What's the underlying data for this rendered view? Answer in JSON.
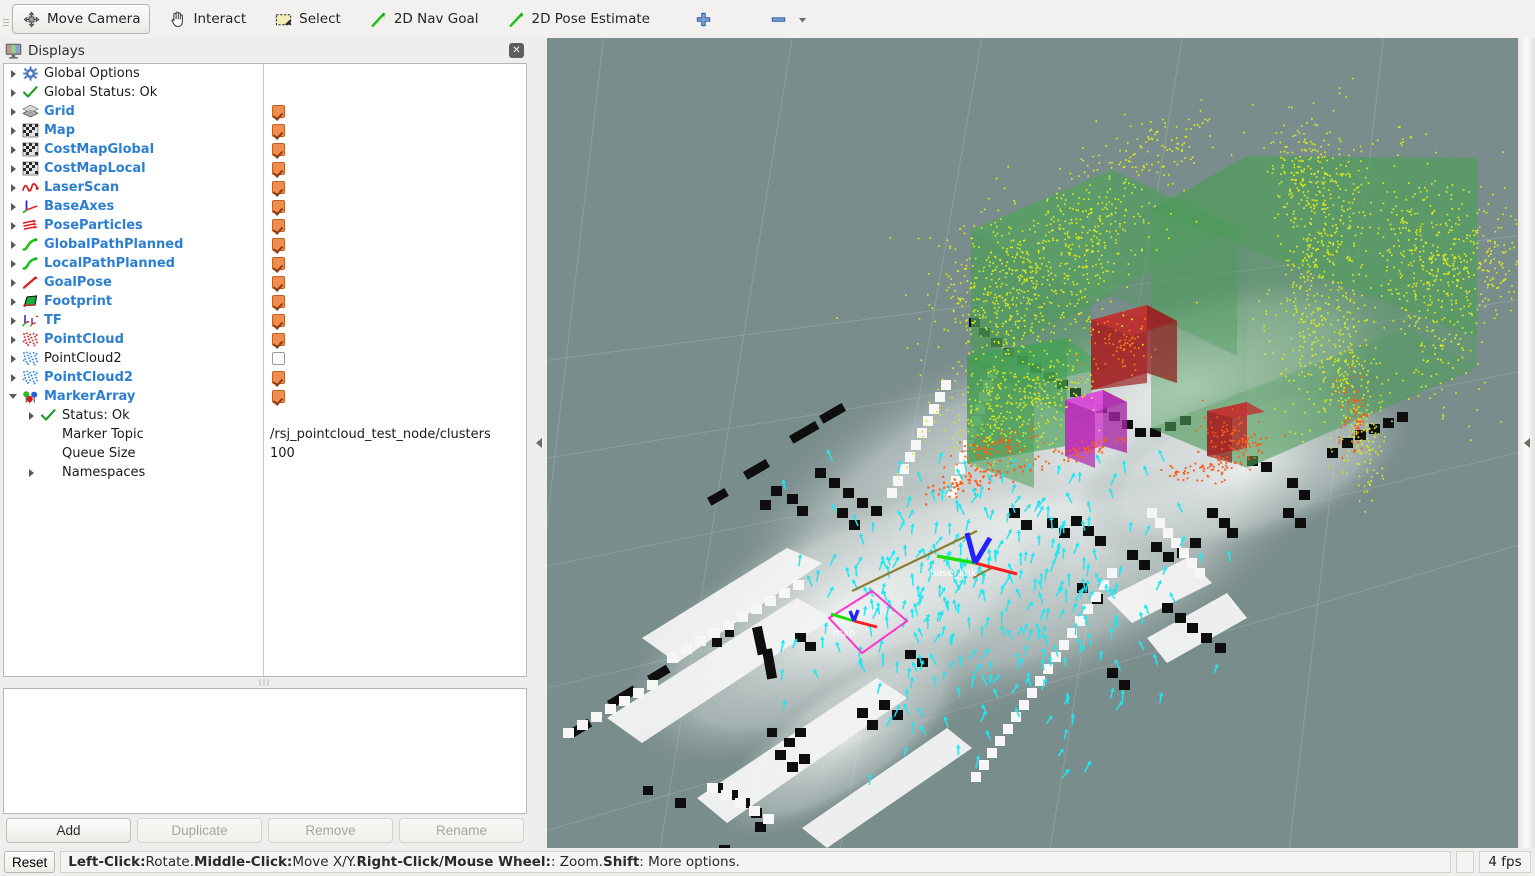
{
  "app": {
    "title": "Displays"
  },
  "toolbar": {
    "grip": "drag-grip",
    "tools": [
      {
        "name": "move-camera",
        "label": "Move Camera",
        "icon": "move-camera-icon",
        "active": true
      },
      {
        "name": "interact",
        "label": "Interact",
        "icon": "hand-cursor-icon",
        "active": false
      },
      {
        "name": "select",
        "label": "Select",
        "icon": "selection-rectangle-icon",
        "active": false
      },
      {
        "name": "2d-nav-goal",
        "label": "2D Nav Goal",
        "icon": "green-arrow-icon",
        "active": false
      },
      {
        "name": "2d-pose-estimate",
        "label": "2D Pose Estimate",
        "icon": "green-arrow-icon",
        "active": false
      }
    ],
    "add_tool_icon": "plus-icon",
    "remove_tool_icon": "minus-icon",
    "remove_tool_dropdown_icon": "chevron-down-icon"
  },
  "displays": {
    "panel_title": "Displays",
    "panel_icon": "displays-monitor-icon",
    "close_icon": "close-icon",
    "tree": [
      {
        "label": "Global Options",
        "icon": "gear-icon",
        "indent": 0,
        "expander": "closed",
        "enabled": false,
        "checkbox": "none",
        "style": "plain"
      },
      {
        "label": "Global Status: Ok",
        "icon": "check-icon",
        "indent": 0,
        "expander": "closed",
        "enabled": false,
        "checkbox": "none",
        "style": "plain"
      },
      {
        "label": "Grid",
        "icon": "grid-icon",
        "indent": 0,
        "expander": "closed",
        "enabled": true,
        "checkbox": "checked",
        "style": "on"
      },
      {
        "label": "Map",
        "icon": "map-icon",
        "indent": 0,
        "expander": "closed",
        "enabled": true,
        "checkbox": "checked",
        "style": "on"
      },
      {
        "label": "CostMapGlobal",
        "icon": "map-icon",
        "indent": 0,
        "expander": "closed",
        "enabled": true,
        "checkbox": "checked",
        "style": "on"
      },
      {
        "label": "CostMapLocal",
        "icon": "map-icon",
        "indent": 0,
        "expander": "closed",
        "enabled": true,
        "checkbox": "checked",
        "style": "on"
      },
      {
        "label": "LaserScan",
        "icon": "laserscan-icon",
        "indent": 0,
        "expander": "closed",
        "enabled": true,
        "checkbox": "checked",
        "style": "on"
      },
      {
        "label": "BaseAxes",
        "icon": "axes-icon",
        "indent": 0,
        "expander": "closed",
        "enabled": true,
        "checkbox": "checked",
        "style": "on"
      },
      {
        "label": "PoseParticles",
        "icon": "pose-array-icon",
        "indent": 0,
        "expander": "closed",
        "enabled": true,
        "checkbox": "checked",
        "style": "on"
      },
      {
        "label": "GlobalPathPlanned",
        "icon": "path-icon",
        "indent": 0,
        "expander": "closed",
        "enabled": true,
        "checkbox": "checked",
        "style": "on"
      },
      {
        "label": "LocalPathPlanned",
        "icon": "path-icon",
        "indent": 0,
        "expander": "closed",
        "enabled": true,
        "checkbox": "checked",
        "style": "on"
      },
      {
        "label": "GoalPose",
        "icon": "pose-icon",
        "indent": 0,
        "expander": "closed",
        "enabled": true,
        "checkbox": "checked",
        "style": "on"
      },
      {
        "label": "Footprint",
        "icon": "polygon-icon",
        "indent": 0,
        "expander": "closed",
        "enabled": true,
        "checkbox": "checked",
        "style": "on"
      },
      {
        "label": "TF",
        "icon": "tf-icon",
        "indent": 0,
        "expander": "closed",
        "enabled": true,
        "checkbox": "checked",
        "style": "on"
      },
      {
        "label": "PointCloud",
        "icon": "pointcloud-red-icon",
        "indent": 0,
        "expander": "closed",
        "enabled": true,
        "checkbox": "checked",
        "style": "on"
      },
      {
        "label": "PointCloud2",
        "icon": "pointcloud-blue-icon",
        "indent": 0,
        "expander": "closed",
        "enabled": false,
        "checkbox": "unchecked",
        "style": "off"
      },
      {
        "label": "PointCloud2",
        "icon": "pointcloud-blue-icon",
        "indent": 0,
        "expander": "closed",
        "enabled": true,
        "checkbox": "checked",
        "style": "on"
      },
      {
        "label": "MarkerArray",
        "icon": "markerarray-icon",
        "indent": 0,
        "expander": "open",
        "enabled": true,
        "checkbox": "checked",
        "style": "on"
      },
      {
        "label": "Status: Ok",
        "icon": "check-icon",
        "indent": 1,
        "expander": "closed",
        "enabled": false,
        "checkbox": "none",
        "style": "plain"
      },
      {
        "label": "Marker Topic",
        "icon": "none",
        "indent": 1,
        "expander": "none",
        "enabled": false,
        "checkbox": "none",
        "style": "plain",
        "value": "/rsj_pointcloud_test_node/clusters"
      },
      {
        "label": "Queue Size",
        "icon": "none",
        "indent": 1,
        "expander": "none",
        "enabled": false,
        "checkbox": "none",
        "style": "plain",
        "value": "100"
      },
      {
        "label": "Namespaces",
        "icon": "none",
        "indent": 1,
        "expander": "closed",
        "enabled": false,
        "checkbox": "none",
        "style": "plain"
      }
    ],
    "buttons": [
      {
        "name": "add-button",
        "label": "Add",
        "enabled": true
      },
      {
        "name": "duplicate-button",
        "label": "Duplicate",
        "enabled": false
      },
      {
        "name": "remove-button",
        "label": "Remove",
        "enabled": false
      },
      {
        "name": "rename-button",
        "label": "Rename",
        "enabled": false
      }
    ]
  },
  "statusbar": {
    "reset_label": "Reset",
    "hints": [
      {
        "key": "Left-Click:",
        "text": " Rotate. "
      },
      {
        "key": "Middle-Click:",
        "text": " Move X/Y. "
      },
      {
        "key": "Right-Click/Mouse Wheel:",
        "text": ": Zoom. "
      },
      {
        "key": "Shift",
        "text": ": More options."
      }
    ],
    "fps": "4 fps"
  },
  "viewport": {
    "name": "3d-render-view",
    "background_color": "#798d8c",
    "grid_color": "#9aabaa",
    "frames": [
      {
        "label": "base_link",
        "color": "#ffffff"
      },
      {
        "label": "map",
        "color": "#ffffff"
      }
    ],
    "colors": {
      "cluster_box_green": "#4e9b5a",
      "cluster_box_red": "#b22222",
      "cluster_box_magenta": "#c832c8",
      "pointcloud_yellow": "#d7ea1e",
      "pointcloud_orange": "#ff5a16",
      "particles_cyan": "#22e6f0",
      "footprint_magenta": "#ff35ce",
      "map_free": "#f2f2f2",
      "map_occupied": "#0a0a0a",
      "axis_x": "#ff1e1e",
      "axis_y": "#18e000",
      "axis_z": "#2222ff",
      "path_olive": "#8a8030"
    },
    "splitter_left_icon": "collapse-left-icon",
    "splitter_right_icon": "collapse-left-icon"
  }
}
